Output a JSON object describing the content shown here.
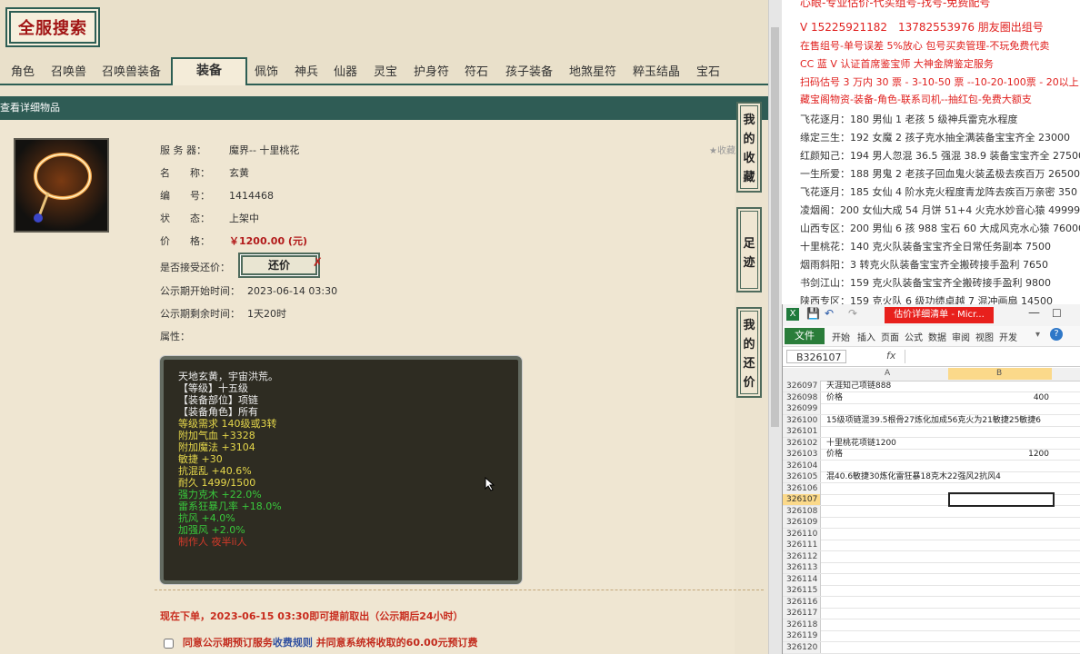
{
  "left": {
    "logo": "全服搜索",
    "tabs": [
      "角色",
      "召唤兽",
      "召唤兽装备",
      "装备",
      "佩饰",
      "神兵",
      "仙器",
      "灵宝",
      "护身符",
      "符石",
      "孩子装备",
      "地煞星符",
      "粹玉结晶",
      "宝石"
    ],
    "active_tab": "装备",
    "section_title": "查看详细物品",
    "fields": [
      {
        "label": "服 务 器：",
        "value": "魔界-- 十里桃花"
      },
      {
        "label": "名　　称：",
        "value": "玄黄"
      },
      {
        "label": "编　　号：",
        "value": "1414468"
      },
      {
        "label": "状　　态：",
        "value": "上架中"
      },
      {
        "label": "价　　格：",
        "value": "￥1200.00 (元)"
      },
      {
        "label": "是否接受还价：",
        "value": ""
      },
      {
        "label": "公示期开始时间：",
        "value": "2023-06-14 03:30"
      },
      {
        "label": "公示期剩余时间：",
        "value": "1天20时"
      },
      {
        "label": "属性：",
        "value": ""
      }
    ],
    "haggle_button": "还价",
    "collect_label": "收藏",
    "attributes": [
      {
        "text": "天地玄黄，宇宙洪荒。",
        "color": "white"
      },
      {
        "text": "【等级】十五级",
        "color": "white"
      },
      {
        "text": "【装备部位】项链",
        "color": "white"
      },
      {
        "text": "【装备角色】所有",
        "color": "white"
      },
      {
        "text": "等级需求 140级或3转",
        "color": "yellow"
      },
      {
        "text": "附加气血 +3328",
        "color": "yellow"
      },
      {
        "text": "附加魔法 +3104",
        "color": "yellow"
      },
      {
        "text": "敏捷 +30",
        "color": "yellow"
      },
      {
        "text": "抗混乱 +40.6%",
        "color": "yellow"
      },
      {
        "text": "耐久 1499/1500",
        "color": "yellow"
      },
      {
        "text": "强力克木 +22.0%",
        "color": "green"
      },
      {
        "text": "雷系狂暴几率 +18.0%",
        "color": "green"
      },
      {
        "text": "抗风 +4.0%",
        "color": "green"
      },
      {
        "text": "加强风 +2.0%",
        "color": "green"
      },
      {
        "text": "制作人 夜半ii人",
        "color": "red"
      }
    ],
    "order_notice": "现在下单，2023-06-15 03:30即可提前取出（公示期后24小时）",
    "agree_prefix": "同意公示期预订服务",
    "agree_link": "收费规则",
    "agree_suffix": "并同意系统将收取的60.00元预订费",
    "side_tabs": [
      "我的收藏",
      "足迹",
      "我的还价"
    ]
  },
  "right": {
    "lines": [
      {
        "text": "心眼-专业估价-代买组号-找号-免费配号",
        "color": "#e0201e",
        "size": "big"
      },
      {
        "text": "V 15225921182　13782553976 朋友圈出组号",
        "color": "#e0201e",
        "size": "big"
      },
      {
        "text": "在售组号-单号误差 5%放心 包号买卖管理-不玩免费代卖",
        "color": "#e0201e"
      },
      {
        "text": "CC 蓝 V 认证首席鉴宝师 大神金牌鉴定服务",
        "color": "#e0201e"
      },
      {
        "text": "扫码估号 3 万内 30 票 - 3-10-50 票 --10-20-100票 - 20以上 150",
        "color": "#e0201e"
      },
      {
        "text": "藏宝阁物资-装备-角色-联系司机--抽红包-免费大额支",
        "color": "#e0201e"
      },
      {
        "text": "飞花逐月：180 男仙 1 老孩 5 级神兵雷克水程度",
        "color": "#333"
      },
      {
        "text": "缘定三生：192 女魔 2 孩子克水抽全满装备宝宝齐全 23000",
        "color": "#333"
      },
      {
        "text": "红颜知己：194 男人忽混 36.5 强混 38.9 装备宝宝齐全 27500",
        "color": "#333"
      },
      {
        "text": "一生所爱：188 男鬼 2 老孩子回血鬼火装孟极去疾百万 26500",
        "color": "#333"
      },
      {
        "text": "飞花逐月：185 女仙 4 阶水克火程度青龙阵去疾百万亲密 350",
        "color": "#333"
      },
      {
        "text": "凌烟阁：200 女仙大成 54 月饼 51+4 火克水妙音心猿 49999",
        "color": "#333"
      },
      {
        "text": "山西专区：200 男仙 6 孩 988 宝石 60 大成风克水心猿 76000",
        "color": "#333"
      },
      {
        "text": "十里桃花：140 克火队装备宝宝齐全日常任务副本 7500",
        "color": "#333"
      },
      {
        "text": "烟雨斜阳：3 转克火队装备宝宝齐全搬砖接手盈利 7650",
        "color": "#333"
      },
      {
        "text": "书剑江山：159 克火队装备宝宝齐全搬砖接手盈利 9800",
        "color": "#333"
      },
      {
        "text": "陕西专区：159 克火队 6 级功绩卓越 7 混冲画扇 14500",
        "color": "#333"
      }
    ]
  },
  "excel": {
    "title": "估价详细清单 - Micr...",
    "ribbon_tabs": [
      "文件",
      "开始",
      "插入",
      "页面",
      "公式",
      "数据",
      "审阅",
      "视图",
      "开发"
    ],
    "name_box": "B326107",
    "fx": "fx",
    "col_a": "A",
    "col_b": "B",
    "rows": [
      {
        "n": "326097",
        "a": "天涯知己项链888",
        "b": ""
      },
      {
        "n": "326098",
        "a": "价格",
        "b": "400"
      },
      {
        "n": "326099",
        "a": "",
        "b": ""
      },
      {
        "n": "326100",
        "a": "15级项链混39.5根骨27炼化加成56克火为21敏捷25敏捷6",
        "b": ""
      },
      {
        "n": "326101",
        "a": "",
        "b": ""
      },
      {
        "n": "326102",
        "a": "十里桃花项链1200",
        "b": ""
      },
      {
        "n": "326103",
        "a": "价格",
        "b": "1200"
      },
      {
        "n": "326104",
        "a": "",
        "b": ""
      },
      {
        "n": "326105",
        "a": "混40.6敏捷30炼化雷狂暴18克木22强风2抗风4",
        "b": ""
      },
      {
        "n": "326106",
        "a": "",
        "b": ""
      },
      {
        "n": "326107",
        "a": "",
        "b": ""
      },
      {
        "n": "326108",
        "a": "",
        "b": ""
      },
      {
        "n": "326109",
        "a": "",
        "b": ""
      },
      {
        "n": "326110",
        "a": "",
        "b": ""
      },
      {
        "n": "326111",
        "a": "",
        "b": ""
      },
      {
        "n": "326112",
        "a": "",
        "b": ""
      },
      {
        "n": "326113",
        "a": "",
        "b": ""
      },
      {
        "n": "326114",
        "a": "",
        "b": ""
      },
      {
        "n": "326115",
        "a": "",
        "b": ""
      },
      {
        "n": "326116",
        "a": "",
        "b": ""
      },
      {
        "n": "326117",
        "a": "",
        "b": ""
      },
      {
        "n": "326118",
        "a": "",
        "b": ""
      },
      {
        "n": "326119",
        "a": "",
        "b": ""
      },
      {
        "n": "326120",
        "a": "",
        "b": ""
      }
    ],
    "selected_row": "326107"
  }
}
